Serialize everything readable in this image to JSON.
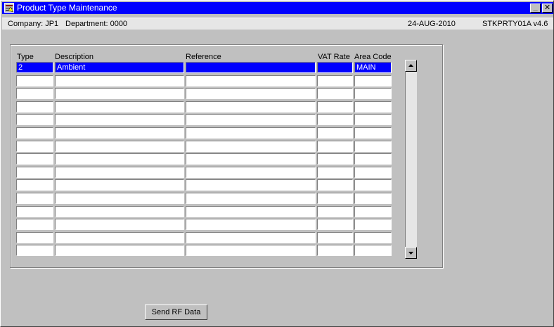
{
  "window": {
    "title": "Product Type Maintenance",
    "minimize_label": "_",
    "close_label": "✕"
  },
  "status": {
    "company": "Company: JP1",
    "department": "Department: 0000",
    "date": "24-AUG-2010",
    "module": "STKPRTY01A  v4.6"
  },
  "table": {
    "columns": [
      "Type",
      "Description",
      "Reference",
      "VAT Rate",
      "Area Code"
    ],
    "rows": [
      [
        "2",
        "Ambient",
        "",
        "",
        "MAIN"
      ],
      [
        "",
        "",
        "",
        "",
        ""
      ],
      [
        "",
        "",
        "",
        "",
        ""
      ],
      [
        "",
        "",
        "",
        "",
        ""
      ],
      [
        "",
        "",
        "",
        "",
        ""
      ],
      [
        "",
        "",
        "",
        "",
        ""
      ],
      [
        "",
        "",
        "",
        "",
        ""
      ],
      [
        "",
        "",
        "",
        "",
        ""
      ],
      [
        "",
        "",
        "",
        "",
        ""
      ],
      [
        "",
        "",
        "",
        "",
        ""
      ],
      [
        "",
        "",
        "",
        "",
        ""
      ],
      [
        "",
        "",
        "",
        "",
        ""
      ],
      [
        "",
        "",
        "",
        "",
        ""
      ],
      [
        "",
        "",
        "",
        "",
        ""
      ],
      [
        "",
        "",
        "",
        "",
        ""
      ]
    ],
    "selected_row": 0
  },
  "buttons": {
    "send_rf": "Send RF Data"
  },
  "icons": {
    "app": "form-icon",
    "scroll_up": "arrow-up-icon",
    "scroll_down": "arrow-down-icon"
  }
}
